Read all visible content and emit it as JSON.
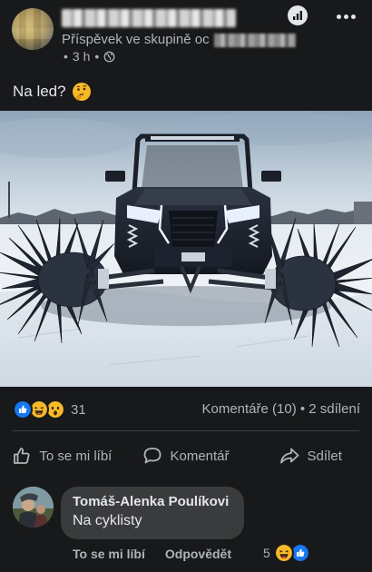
{
  "post": {
    "author_redacted": true,
    "group_prefix": "Příspěvek ve skupině oc",
    "time": "3 h",
    "separator": "•",
    "text": "Na led?",
    "text_emoji": "thinking-face-icon"
  },
  "stats": {
    "reaction_icons": [
      "like-icon",
      "haha-icon",
      "wow-icon"
    ],
    "reaction_count": "31",
    "comments_shares": "Komentáře (10) • 2 sdílení"
  },
  "actions": {
    "like_label": "To se mi líbí",
    "comment_label": "Komentář",
    "share_label": "Sdílet"
  },
  "comment": {
    "author": "Tomáš-Alenka Poulíkovi",
    "text": "Na cyklisty",
    "like_label": "To se mi líbí",
    "reply_label": "Odpovědět",
    "reaction_count": "5",
    "reaction_icons": [
      "haha-icon",
      "like-icon"
    ]
  },
  "colors": {
    "background": "#18191a",
    "text_primary": "#e4e6eb",
    "text_secondary": "#b0b3b8",
    "bubble": "#3a3b3c",
    "like_blue": "#1877f2",
    "reaction_yellow": "#f7b928"
  }
}
